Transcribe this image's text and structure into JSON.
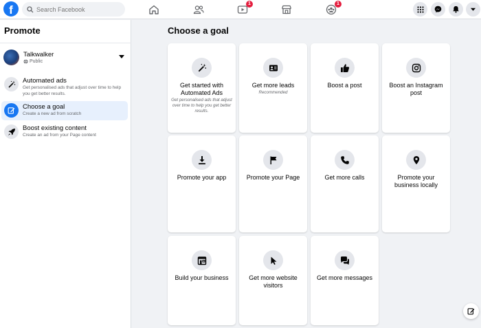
{
  "header": {
    "logo_letter": "f",
    "search": {
      "placeholder": "Search Facebook"
    },
    "nav": [
      {
        "name": "home",
        "badge": ""
      },
      {
        "name": "friends",
        "badge": ""
      },
      {
        "name": "watch",
        "badge": "1"
      },
      {
        "name": "marketplace",
        "badge": ""
      },
      {
        "name": "groups",
        "badge": "1"
      }
    ],
    "right": [
      "menu-grid-icon",
      "messenger-icon",
      "notifications-icon",
      "account-chevron-icon"
    ]
  },
  "sidebar": {
    "title": "Promote",
    "page": {
      "name": "Talkwalker",
      "privacy": "Public"
    },
    "items": [
      {
        "label": "Automated ads",
        "desc": "Get personalised ads that adjust over time to help you get better results."
      },
      {
        "label": "Choose a goal",
        "desc": "Create a new ad from scratch"
      },
      {
        "label": "Boost existing content",
        "desc": "Create an ad from your Page content"
      }
    ]
  },
  "main": {
    "title": "Choose a goal",
    "cards": [
      {
        "title": "Get started with Automated Ads",
        "sub": "Get personalised ads that adjust over time to help you get better results.",
        "icon": "magic-wand-icon"
      },
      {
        "title": "Get more leads",
        "sub": "Recommended",
        "icon": "contact-card-icon"
      },
      {
        "title": "Boost a post",
        "sub": "",
        "icon": "thumbs-up-icon"
      },
      {
        "title": "Boost an Instagram post",
        "sub": "",
        "icon": "instagram-icon"
      },
      {
        "title": "Promote your app",
        "sub": "",
        "icon": "download-icon"
      },
      {
        "title": "Promote your Page",
        "sub": "",
        "icon": "flag-icon"
      },
      {
        "title": "Get more calls",
        "sub": "",
        "icon": "phone-icon"
      },
      {
        "title": "Promote your business locally",
        "sub": "",
        "icon": "location-pin-icon"
      },
      {
        "title": "Build your business",
        "sub": "",
        "icon": "storefront-icon"
      },
      {
        "title": "Get more website visitors",
        "sub": "",
        "icon": "cursor-icon"
      },
      {
        "title": "Get more messages",
        "sub": "",
        "icon": "chat-bubbles-icon"
      }
    ]
  },
  "colors": {
    "brand": "#1877f2",
    "badge": "#e41e3f",
    "active_bg": "#e7f0fd",
    "page_bg": "#f0f2f5"
  }
}
